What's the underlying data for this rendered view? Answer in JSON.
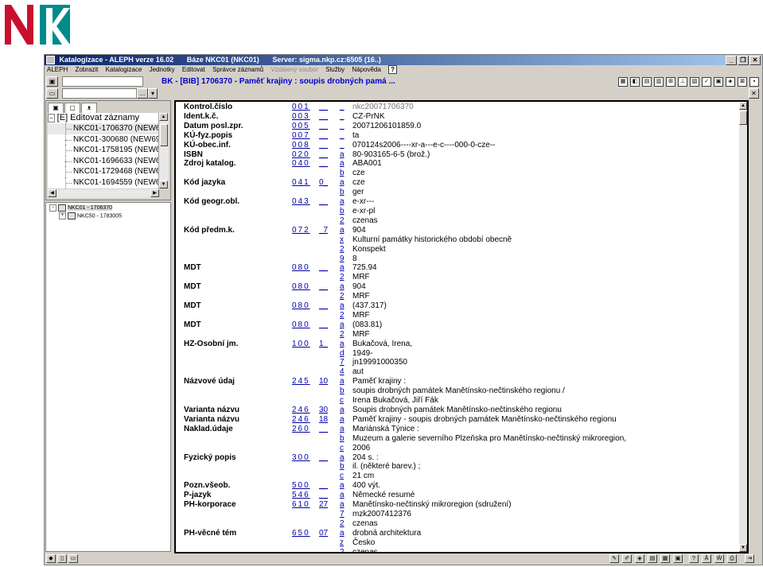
{
  "logo": {
    "text": "NK"
  },
  "window": {
    "title_segments": [
      "Katalogizace - ALEPH verze 16.02",
      "Báze NKC01 (NKC01)",
      "Server: sigma.nkp.cz:6505 (16..)"
    ],
    "buttons": [
      "_",
      "❐",
      "✕"
    ]
  },
  "menu": {
    "items": [
      "ALEPH",
      "Zobrazit",
      "Katalogizace",
      "Jednotky",
      "Editovat",
      "Správce záznamů"
    ],
    "disabled_items": [
      "Vzdálený soubor"
    ],
    "items_after": [
      "Služby",
      "Nápověda"
    ],
    "help_icon": "?"
  },
  "toolbar": {
    "path": "BK - [BIB] 1706370 - Paměť krajiny : soupis drobných pamá ...",
    "dots": "..."
  },
  "left_panel": {
    "header": "[E] Editovat záznamy",
    "records": [
      "NKC01-1706370 (NEW6",
      "NKC01-300680 (NEW69",
      "NKC01-1758195 (NEW6",
      "NKC01-1696633 (NEW6",
      "NKC01-1729468 (NEW6",
      "NKC01-1694559 (NEW6"
    ],
    "tree": [
      {
        "label": "NKC01 - 1706370",
        "expander": "−",
        "indent": 0
      },
      {
        "label": "NKC50 - 1783005",
        "expander": "+",
        "indent": 12
      }
    ]
  },
  "fields": [
    {
      "label": "Kontrol.číslo",
      "tag": "001",
      "ind": "__",
      "sub": "_",
      "value": "nkc20071706370",
      "gray": true
    },
    {
      "label": "Ident.k.č.",
      "tag": "003",
      "ind": "__",
      "sub": "_",
      "value": "CZ-PrNK"
    },
    {
      "label": "Datum posl.zpr.",
      "tag": "005",
      "ind": "__",
      "sub": "_",
      "value": "20071206101859.0"
    },
    {
      "label": "KÚ-fyz.popis",
      "tag": "007",
      "ind": "__",
      "sub": "_",
      "value": "ta"
    },
    {
      "label": "KÚ-obec.inf.",
      "tag": "008",
      "ind": "__",
      "sub": "_",
      "value": "070124s2006----xr-a---e-c----000-0-cze--"
    },
    {
      "label": "ISBN",
      "tag": "020",
      "ind": "__",
      "sub": "a",
      "value": "80-903165-6-5 (brož.)"
    },
    {
      "label": "Zdroj katalog.",
      "tag": "040",
      "ind": "__",
      "sub": "a",
      "value": "ABA001"
    },
    {
      "label": "",
      "tag": "",
      "ind": "",
      "sub": "b",
      "value": "cze"
    },
    {
      "label": "Kód jazyka",
      "tag": "041",
      "ind": "0_",
      "sub": "a",
      "value": "cze"
    },
    {
      "label": "",
      "tag": "",
      "ind": "",
      "sub": "b",
      "value": "ger"
    },
    {
      "label": "Kód geogr.obl.",
      "tag": "043",
      "ind": "__",
      "sub": "a",
      "value": "e-xr---"
    },
    {
      "label": "",
      "tag": "",
      "ind": "",
      "sub": "b",
      "value": "e-xr-pl"
    },
    {
      "label": "",
      "tag": "",
      "ind": "",
      "sub": "2",
      "value": "czenas"
    },
    {
      "label": "Kód předm.k.",
      "tag": "072",
      "ind": "_7",
      "sub": "a",
      "value": "904"
    },
    {
      "label": "",
      "tag": "",
      "ind": "",
      "sub": "x",
      "value": "Kulturní památky historického období obecně"
    },
    {
      "label": "",
      "tag": "",
      "ind": "",
      "sub": "2",
      "value": "Konspekt"
    },
    {
      "label": "",
      "tag": "",
      "ind": "",
      "sub": "9",
      "value": "8"
    },
    {
      "label": "MDT",
      "tag": "080",
      "ind": "__",
      "sub": "a",
      "value": "725.94"
    },
    {
      "label": "",
      "tag": "",
      "ind": "",
      "sub": "2",
      "value": "MRF"
    },
    {
      "label": "MDT",
      "tag": "080",
      "ind": "__",
      "sub": "a",
      "value": "904"
    },
    {
      "label": "",
      "tag": "",
      "ind": "",
      "sub": "2",
      "value": "MRF"
    },
    {
      "label": "MDT",
      "tag": "080",
      "ind": "__",
      "sub": "a",
      "value": "(437.317)"
    },
    {
      "label": "",
      "tag": "",
      "ind": "",
      "sub": "2",
      "value": "MRF"
    },
    {
      "label": "MDT",
      "tag": "080",
      "ind": "__",
      "sub": "a",
      "value": "(083.81)"
    },
    {
      "label": "",
      "tag": "",
      "ind": "",
      "sub": "2",
      "value": "MRF"
    },
    {
      "label": "HZ-Osobní jm.",
      "tag": "100",
      "ind": "1_",
      "sub": "a",
      "value": "Bukačová, Irena,"
    },
    {
      "label": "",
      "tag": "",
      "ind": "",
      "sub": "d",
      "value": "1949-"
    },
    {
      "label": "",
      "tag": "",
      "ind": "",
      "sub": "7",
      "value": "jn19991000350"
    },
    {
      "label": "",
      "tag": "",
      "ind": "",
      "sub": "4",
      "value": "aut"
    },
    {
      "label": "Názvové údaj",
      "tag": "245",
      "ind": "10",
      "sub": "a",
      "value": "Paměť krajiny :"
    },
    {
      "label": "",
      "tag": "",
      "ind": "",
      "sub": "b",
      "value": "soupis drobných památek Manětínsko-nečtinského regionu /"
    },
    {
      "label": "",
      "tag": "",
      "ind": "",
      "sub": "c",
      "value": "Irena Bukačová, Jiří Fák"
    },
    {
      "label": "Varianta názvu",
      "tag": "246",
      "ind": "30",
      "sub": "a",
      "value": "Soupis drobných památek Manětínsko-nečtinského regionu"
    },
    {
      "label": "Varianta názvu",
      "tag": "246",
      "ind": "18",
      "sub": "a",
      "value": "Paměť krajiny - soupis drobných památek Manětínsko-nečtinského regionu"
    },
    {
      "label": "Naklad.údaje",
      "tag": "260",
      "ind": "__",
      "sub": "a",
      "value": "Mariánská Týnice :"
    },
    {
      "label": "",
      "tag": "",
      "ind": "",
      "sub": "b",
      "value": "Muzeum a galerie severního Plzeňska pro Manětínsko-nečtinský mikroregion,"
    },
    {
      "label": "",
      "tag": "",
      "ind": "",
      "sub": "c",
      "value": "2006"
    },
    {
      "label": "Fyzický popis",
      "tag": "300",
      "ind": "__",
      "sub": "a",
      "value": "204 s. :"
    },
    {
      "label": "",
      "tag": "",
      "ind": "",
      "sub": "b",
      "value": "il. (některé barev.) ;"
    },
    {
      "label": "",
      "tag": "",
      "ind": "",
      "sub": "c",
      "value": "21 cm"
    },
    {
      "label": "Pozn.všeob.",
      "tag": "500",
      "ind": "__",
      "sub": "a",
      "value": "400 výt."
    },
    {
      "label": "P-jazyk",
      "tag": "546",
      "ind": "__",
      "sub": "a",
      "value": "Německé resumé"
    },
    {
      "label": "PH-korporace",
      "tag": "610",
      "ind": "27",
      "sub": "a",
      "value": "Manětínsko-nečtinský mikroregion (sdružení)"
    },
    {
      "label": "",
      "tag": "",
      "ind": "",
      "sub": "7",
      "value": "mzk2007412376"
    },
    {
      "label": "",
      "tag": "",
      "ind": "",
      "sub": "2",
      "value": "czenas"
    },
    {
      "label": "PH-věcné tém",
      "tag": "650",
      "ind": "07",
      "sub": "a",
      "value": "drobná architektura"
    },
    {
      "label": "",
      "tag": "",
      "ind": "",
      "sub": "z",
      "value": "Česko"
    },
    {
      "label": "",
      "tag": "",
      "ind": "",
      "sub": "2",
      "value": "czenas"
    }
  ],
  "colors": {
    "title_start": "#0a246a",
    "title_end": "#a6caf0",
    "logo_red": "#c8102e",
    "logo_teal": "#008b8b",
    "link_blue": "#0000aa"
  }
}
